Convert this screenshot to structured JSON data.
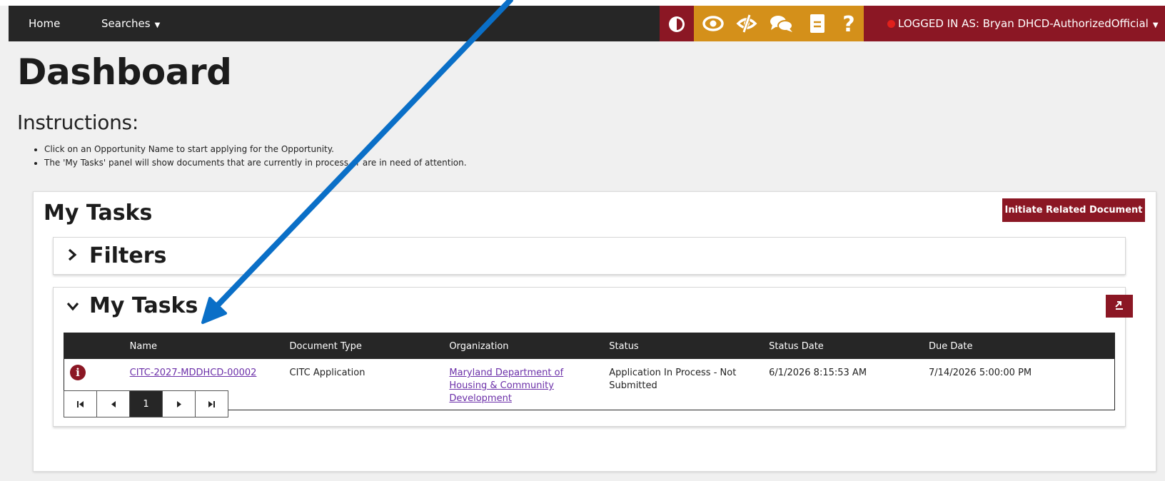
{
  "nav": {
    "home": "Home",
    "searches": "Searches",
    "login_text": "LOGGED IN AS: Bryan DHCD-AuthorizedOfficial",
    "tool_icons": [
      "contrast-icon",
      "eye-icon",
      "eye-slash-icon",
      "chat-icon",
      "book-icon",
      "help-icon"
    ]
  },
  "colors": {
    "navbar": "#262626",
    "brand": "#8b1724",
    "tools": "#d4901a",
    "link": "#6b2fa8",
    "arrow": "#0a6fc7"
  },
  "page": {
    "title": "Dashboard",
    "instructions_title": "Instructions:",
    "instructions": [
      "Click on an Opportunity Name to start applying for the Opportunity.",
      "The 'My Tasks' panel will show documents that are currently in process or are in need of attention."
    ]
  },
  "panel": {
    "title": "My Tasks",
    "initiate_button": "Initiate Related Document",
    "filters_title": "Filters",
    "tasks_title": "My Tasks"
  },
  "table": {
    "headers": [
      "Name",
      "Document Type",
      "Organization",
      "Status",
      "Status Date",
      "Due Date"
    ],
    "rows": [
      {
        "icon": "info-icon",
        "name": "CITC-2027-MDDHCD-00002",
        "document_type": "CITC Application",
        "organization": "Maryland Department of Housing & Community Development",
        "status": "Application In Process - Not Submitted",
        "status_date": "6/1/2026 8:15:53 AM",
        "due_date": "7/14/2026 5:00:00 PM"
      }
    ]
  },
  "pager": {
    "current_page": "1"
  }
}
